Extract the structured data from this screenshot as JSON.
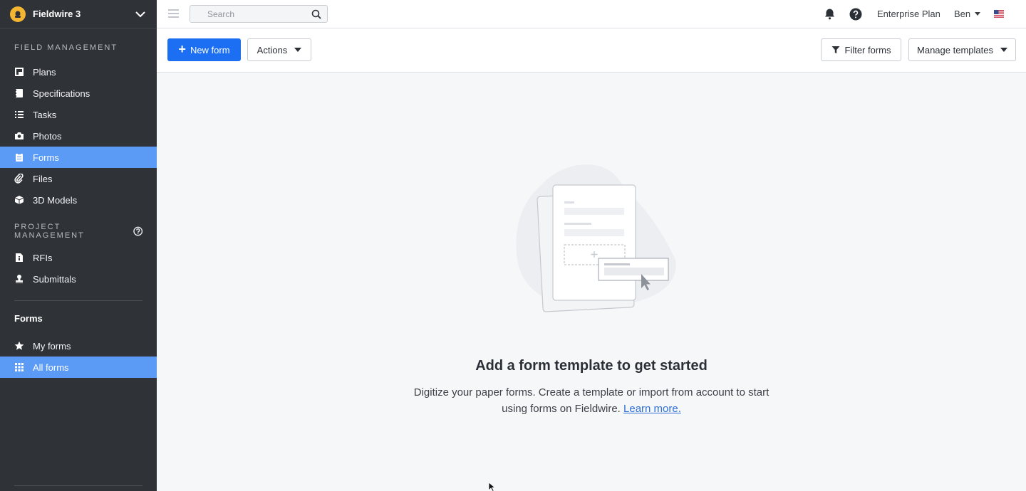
{
  "project": {
    "name": "Fieldwire 3"
  },
  "sidebar": {
    "field_title": "FIELD MANAGEMENT",
    "field_items": [
      {
        "label": "Plans",
        "icon": "plans-icon"
      },
      {
        "label": "Specifications",
        "icon": "specifications-icon"
      },
      {
        "label": "Tasks",
        "icon": "tasks-icon"
      },
      {
        "label": "Photos",
        "icon": "camera-icon"
      },
      {
        "label": "Forms",
        "icon": "clipboard-icon",
        "active": true
      },
      {
        "label": "Files",
        "icon": "paperclip-icon"
      },
      {
        "label": "3D Models",
        "icon": "cube-icon"
      }
    ],
    "project_title": "PROJECT MANAGEMENT",
    "project_items": [
      {
        "label": "RFIs",
        "icon": "rfi-icon"
      },
      {
        "label": "Submittals",
        "icon": "stamp-icon"
      }
    ],
    "forms_title": "Forms",
    "forms_items": [
      {
        "label": "My forms",
        "icon": "star-icon"
      },
      {
        "label": "All forms",
        "icon": "grid-icon",
        "active": true
      }
    ]
  },
  "topbar": {
    "search_placeholder": "Search",
    "plan_label": "Enterprise Plan",
    "user_name": "Ben"
  },
  "toolbar": {
    "new_form_label": "New form",
    "actions_label": "Actions",
    "filter_label": "Filter forms",
    "manage_label": "Manage templates"
  },
  "empty_state": {
    "title": "Add a form template to get started",
    "description": "Digitize your paper forms. Create a template or import from account to start using forms on Fieldwire.",
    "link_text": "Learn more."
  },
  "colors": {
    "sidebar_bg": "#2f3237",
    "active_item": "#5c9bf5",
    "primary_button": "#1c6ef2",
    "link": "#2f6fd6"
  }
}
